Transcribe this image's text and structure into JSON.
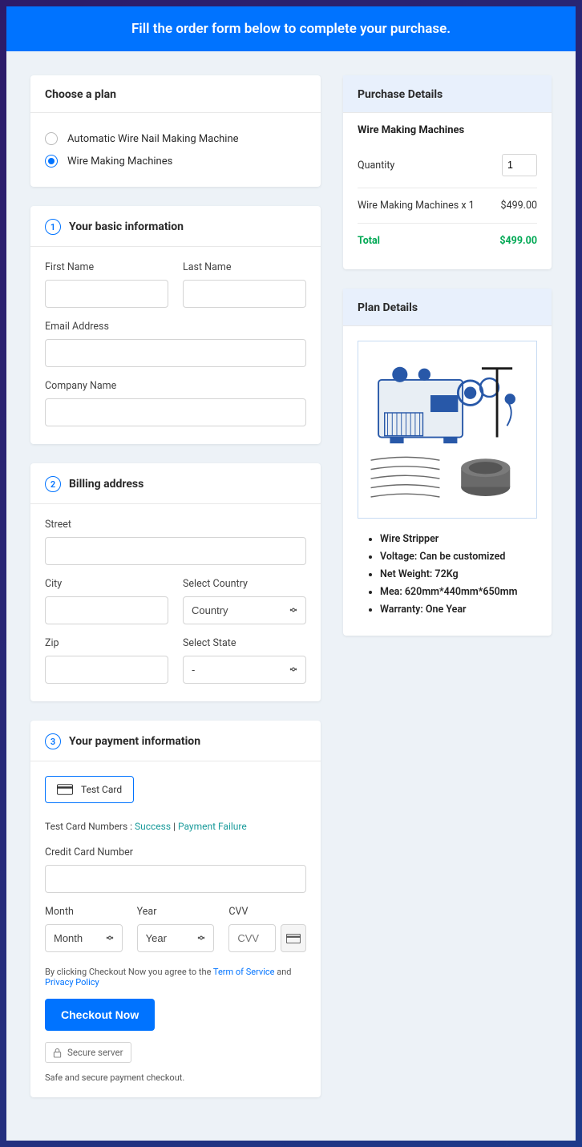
{
  "banner": {
    "text": "Fill the order form below to complete your purchase."
  },
  "plan_section": {
    "title": "Choose a plan",
    "options": [
      {
        "label": "Automatic Wire Nail Making Machine",
        "selected": false
      },
      {
        "label": "Wire Making Machines",
        "selected": true
      }
    ]
  },
  "basic_info": {
    "step": "1",
    "title": "Your basic information",
    "first_name_label": "First Name",
    "last_name_label": "Last Name",
    "email_label": "Email Address",
    "company_label": "Company Name"
  },
  "billing": {
    "step": "2",
    "title": "Billing address",
    "street_label": "Street",
    "city_label": "City",
    "country_label": "Select Country",
    "country_placeholder": "Country",
    "zip_label": "Zip",
    "state_label": "Select State",
    "state_placeholder": "-"
  },
  "payment": {
    "step": "3",
    "title": "Your payment information",
    "card_badge": "Test  Card",
    "test_prefix": "Test Card Numbers : ",
    "success_link": "Success",
    "sep": " | ",
    "failure_link": "Payment Failure",
    "cc_label": "Credit Card Number",
    "month_label": "Month",
    "month_placeholder": "Month",
    "year_label": "Year",
    "year_placeholder": "Year",
    "cvv_label": "CVV",
    "cvv_placeholder": "CVV",
    "terms_prefix": "By clicking Checkout Now you agree to the ",
    "terms_link": "Term of Service",
    "terms_and": " and ",
    "privacy_link": "Privacy Policy",
    "checkout_btn": "Checkout Now",
    "secure_label": "Secure server",
    "secure_note": "Safe and secure payment checkout."
  },
  "purchase": {
    "title": "Purchase Details",
    "product_name": "Wire Making Machines",
    "quantity_label": "Quantity",
    "quantity_value": "1",
    "line_item_label": "Wire Making Machines x 1",
    "line_item_price": "$499.00",
    "total_label": "Total",
    "total_value": "$499.00"
  },
  "plan_details": {
    "title": "Plan Details",
    "items": [
      "Wire Stripper",
      "Voltage: Can be customized",
      "Net Weight: 72Kg",
      "Mea: 620mm*440mm*650mm",
      "Warranty: One Year"
    ]
  }
}
